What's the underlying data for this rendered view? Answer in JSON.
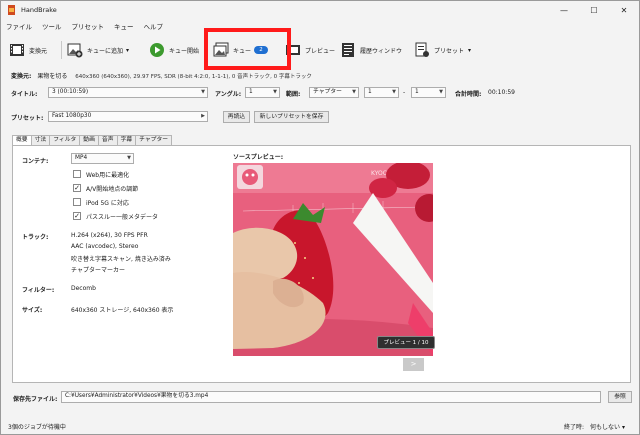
{
  "window": {
    "title": "HandBrake",
    "minimize": "—",
    "maximize": "☐",
    "close": "✕"
  },
  "menu": [
    "ファイル",
    "ツール",
    "プリセット",
    "キュー",
    "ヘルプ"
  ],
  "toolbar": {
    "open_source": "変換元",
    "add_to_queue": "キューに追加",
    "start_queue": "キュー開始",
    "queue": "キュー",
    "queue_count": "2",
    "preview": "プレビュー",
    "activity_window": "履歴ウィンドウ",
    "presets": "プリセット"
  },
  "source": {
    "label": "変換元:",
    "name": "果物を切る",
    "info": "640x360 (640x360), 29.97 FPS, SDR (8-bit 4:2:0, 1-1-1), 0 音声トラック, 0 字幕トラック"
  },
  "title_row": {
    "title_label": "タイトル:",
    "title_value": "3 (00:10:59)",
    "angle_label": "アングル:",
    "angle_value": "1",
    "range_label": "範囲:",
    "range_type": "チャプター",
    "range_start": "1",
    "range_dash": "-",
    "range_end": "1",
    "duration_label": "合計時間:",
    "duration_value": "00:10:59"
  },
  "preset_row": {
    "label": "プリセット:",
    "value": "Fast 1080p30",
    "reload": "再読込",
    "save_new": "新しいプリセットを保存"
  },
  "tabs": [
    "概要",
    "寸法",
    "フィルタ",
    "動画",
    "音声",
    "字幕",
    "チャプター"
  ],
  "summary": {
    "container_label": "コンテナ:",
    "container_value": "MP4",
    "options": [
      {
        "label": "Web用に最適化",
        "checked": false
      },
      {
        "label": "A/V開始地点の調節",
        "checked": true
      },
      {
        "label": "iPod 5G に対応",
        "checked": false
      },
      {
        "label": "パススルー一般メタデータ",
        "checked": true
      }
    ],
    "tracks_label": "トラック:",
    "tracks": [
      "H.264 (x264), 30 FPS PFR",
      "AAC (avcodec), Stereo",
      "吹き替え字幕スキャン, 焼き込み済み",
      "チャプターマーカー"
    ],
    "filters_label": "フィルター:",
    "filters_value": "Decomb",
    "size_label": "サイズ:",
    "size_value": "640x360 ストレージ, 640x360 表示",
    "preview_label": "ソースプレビュー:",
    "preview_button": "プレビュー 1 / 10",
    "preview_next": ">",
    "watermark": "KYOCERA"
  },
  "destination": {
    "label": "保存先ファイル:",
    "path": "C:¥Users¥Administrator¥Videos¥果物を切る3.mp4",
    "browse": "参照"
  },
  "status": {
    "jobs": "3個のジョブが待機中",
    "when_done_label": "終了時:",
    "when_done_value": "何もしない"
  },
  "colors": {
    "highlight": "#ff1a1a",
    "badge": "#1f6fd1",
    "board": "#e85a79"
  }
}
